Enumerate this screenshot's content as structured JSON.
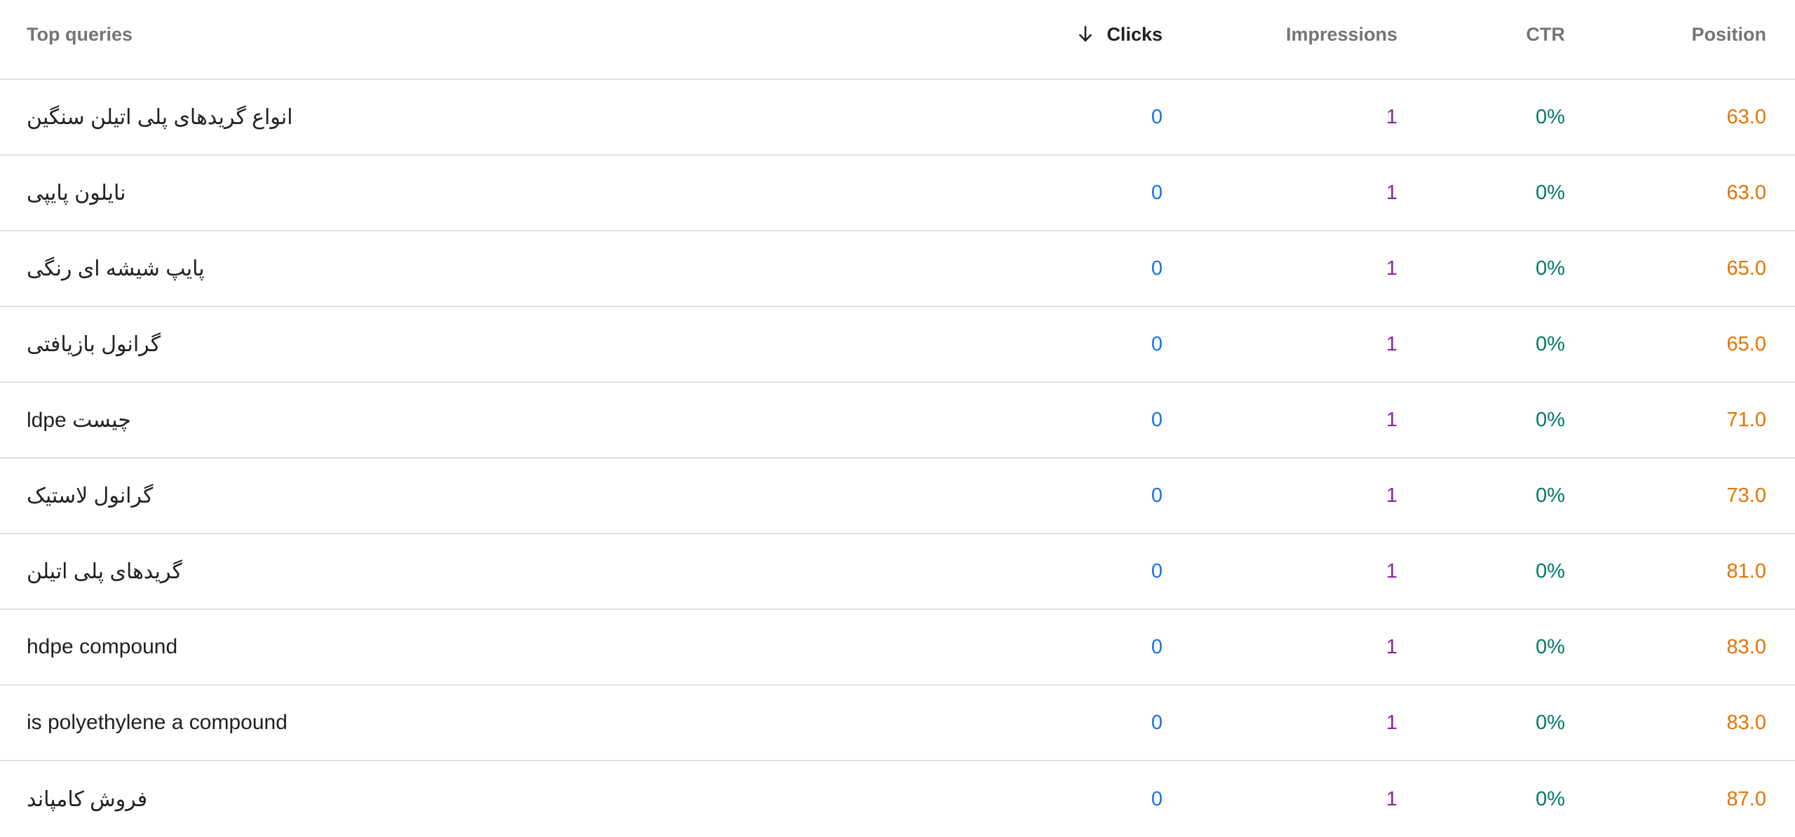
{
  "header": {
    "query_label": "Top queries",
    "clicks_label": "Clicks",
    "impressions_label": "Impressions",
    "ctr_label": "CTR",
    "position_label": "Position",
    "sort_icon": "arrow-downward-icon",
    "sorted_column": "Clicks",
    "sort_direction": "descending"
  },
  "colors": {
    "clicks": "#1a73e8",
    "impressions": "#8e24aa",
    "ctr": "#00796b",
    "position": "#e37400"
  },
  "rows": [
    {
      "query": "انواع گریدهای پلی اتیلن سنگین",
      "clicks": "0",
      "impressions": "1",
      "ctr": "0%",
      "position": "63.0"
    },
    {
      "query": "نایلون پایپی",
      "clicks": "0",
      "impressions": "1",
      "ctr": "0%",
      "position": "63.0"
    },
    {
      "query": "پایپ شیشه ای رنگی",
      "clicks": "0",
      "impressions": "1",
      "ctr": "0%",
      "position": "65.0"
    },
    {
      "query": "گرانول بازیافتی",
      "clicks": "0",
      "impressions": "1",
      "ctr": "0%",
      "position": "65.0"
    },
    {
      "query": "ldpe چیست",
      "clicks": "0",
      "impressions": "1",
      "ctr": "0%",
      "position": "71.0"
    },
    {
      "query": "گرانول لاستیک",
      "clicks": "0",
      "impressions": "1",
      "ctr": "0%",
      "position": "73.0"
    },
    {
      "query": "گریدهای پلی اتیلن",
      "clicks": "0",
      "impressions": "1",
      "ctr": "0%",
      "position": "81.0"
    },
    {
      "query": "hdpe compound",
      "clicks": "0",
      "impressions": "1",
      "ctr": "0%",
      "position": "83.0"
    },
    {
      "query": "is polyethylene a compound",
      "clicks": "0",
      "impressions": "1",
      "ctr": "0%",
      "position": "83.0"
    },
    {
      "query": "فروش کامپاند",
      "clicks": "0",
      "impressions": "1",
      "ctr": "0%",
      "position": "87.0"
    }
  ]
}
